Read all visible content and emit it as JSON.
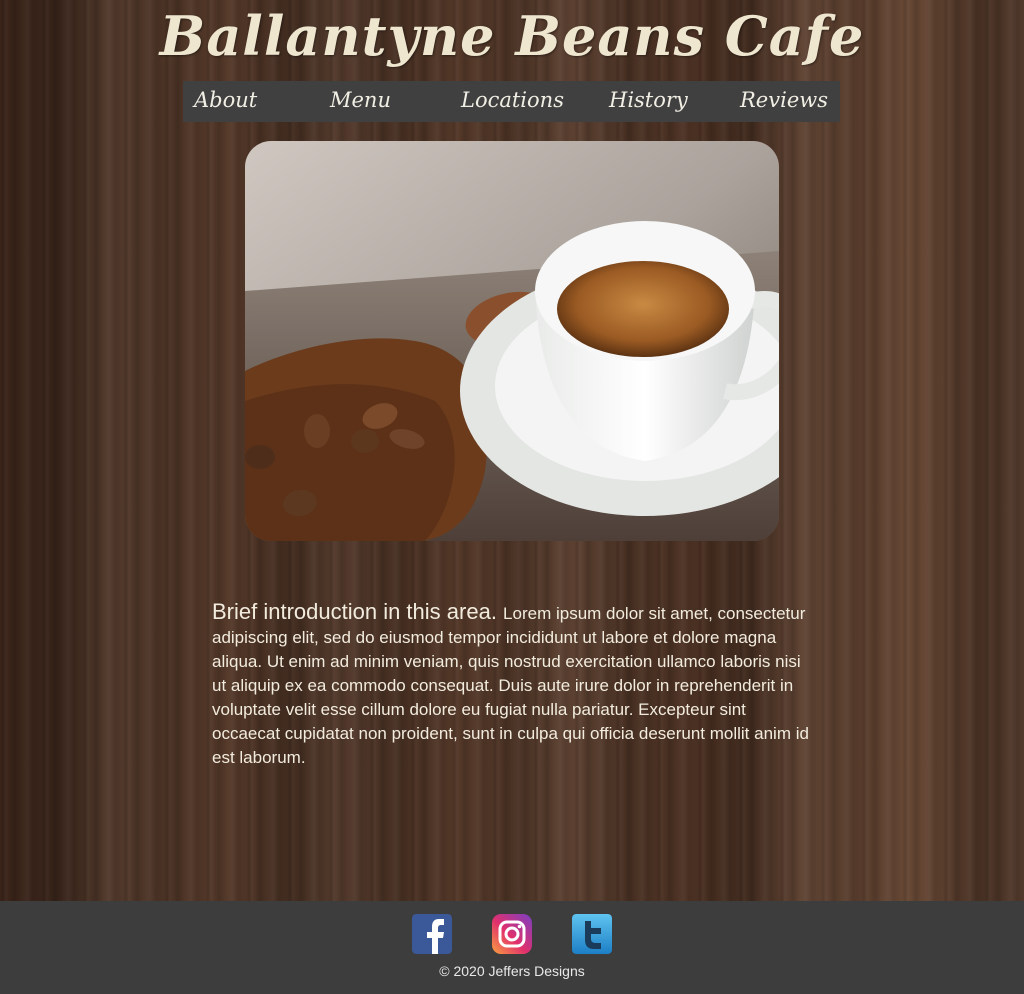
{
  "header": {
    "title": "Ballantyne Beans Cafe"
  },
  "nav": {
    "items": [
      "About",
      "Menu",
      "Locations",
      "History",
      "Reviews"
    ]
  },
  "hero": {
    "image": "espresso-cup-with-coffee-beans"
  },
  "intro": {
    "lead": "Brief introduction in this area.",
    "body": "Lorem ipsum dolor sit amet, consectetur adipiscing elit, sed do eiusmod tempor incididunt ut labore et dolore magna aliqua. Ut enim ad minim veniam, quis nostrud exercitation ullamco laboris nisi ut aliquip ex ea commodo consequat. Duis aute irure dolor in reprehenderit in voluptate velit esse cillum dolore eu fugiat nulla pariatur. Excepteur sint occaecat cupidatat non proident, sunt in culpa qui officia deserunt mollit anim id est laborum."
  },
  "footer": {
    "social": [
      "facebook-icon",
      "instagram-icon",
      "twitter-icon"
    ],
    "copyright": "© 2020 Jeffers Designs"
  },
  "colors": {
    "nav_bg": "#414040",
    "footer_bg": "#3d3d3d",
    "title": "#eee6cf",
    "text": "#f2ecde"
  }
}
